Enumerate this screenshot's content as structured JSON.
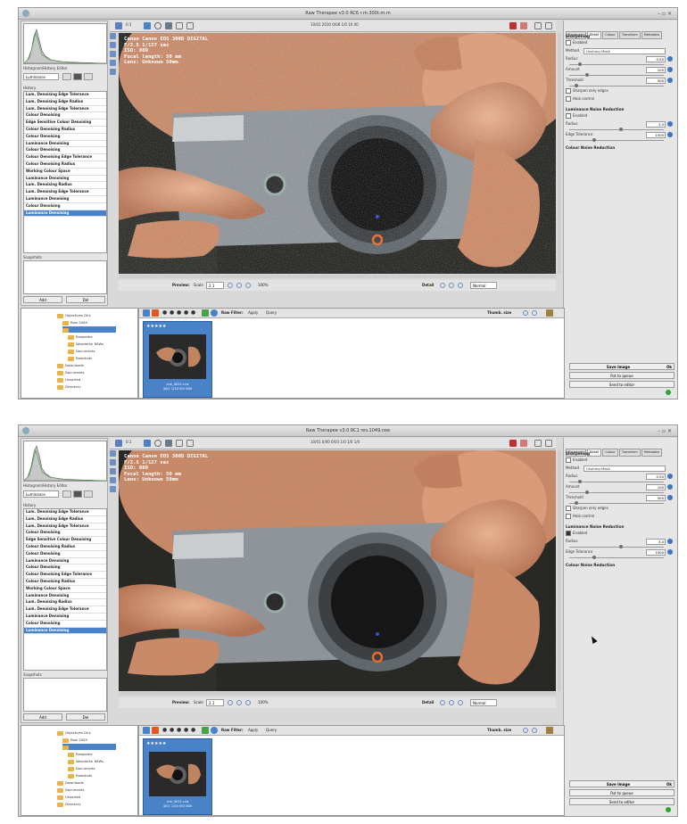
{
  "screens": [
    {
      "window_title": "Raw Therapee v3.0 RC6 r.m.300t.m.m",
      "photo_time": "10/01 2010 0/08 1/0 10 00",
      "exif": [
        "Canon Canon EOS 300D DIGITAL",
        "F/2.5 1/127 sec",
        "ISO: 800",
        "Focal length: 50 mm",
        "Lens: Unknown 50mm"
      ],
      "noise": "heavy",
      "cursor": false
    },
    {
      "window_title": "Raw Therapee v3.0 RC1 rev.1049.raw",
      "photo_time": "10/01 0/00 0/03 1/0 1/0 1/0",
      "exif": [
        "Canon Canon EOS 300D DIGITAL",
        "F/2.5 1/127 sec",
        "ISO: 800",
        "Focal length: 50 mm",
        "Lens: Unknown 50mm"
      ],
      "noise": "low",
      "cursor": true
    }
  ],
  "left_panel": {
    "histogram_label": "Histogram/History Editor",
    "histogram_select": "Luminance",
    "history_title": "History",
    "history_items": [
      "Lum. Denoising Edge Tolerance",
      "Lum. Denoising Edge Radius",
      "Lum. Denoising Edge Tolerance",
      "Colour Denoising",
      "Edge Sensitive Colour Denoising",
      "Colour Denoising Radius",
      "Colour Denoising",
      "Luminance Denoising",
      "Colour Denoising",
      "Colour Denoising Edge Tolerance",
      "Colour Denoising Radius",
      "Working Colour Space",
      "Luminance Denoising",
      "Lum. Denoising Radius",
      "Lum. Denoising Edge Tolerance",
      "Luminance Denoising",
      "Colour Denoising",
      "Luminance Denoising"
    ],
    "snapshot_title": "Snapshots",
    "snap_add": "Add",
    "snap_del": "Del"
  },
  "toolbar": {
    "left_text": "0:1"
  },
  "preview_bar": {
    "preview_label": "Preview:",
    "scale_label": "Scale",
    "scale_value": "2.1",
    "fit_label": "100%",
    "detail_label": "Detail",
    "detail_select": "Normal"
  },
  "right_panel": {
    "tabs": [
      "Exposure",
      "Detail",
      "Colour",
      "Transform",
      "Metadata"
    ],
    "sharpening_title": "Sharpening",
    "enabled_label": "Enabled",
    "method_label": "Method",
    "method_value": "Unsharp Mask",
    "radius_label": "Radius",
    "radius_value": "0.50",
    "amount_label": "Amount",
    "amount_value": "100",
    "threshold_label": "Threshold",
    "threshold_value": "500",
    "sharpen_edges_label": "Sharpen only edges",
    "halo_label": "Halo control",
    "lum_title": "Luminance Noise Reduction",
    "lum_radius_label": "Radius",
    "lum_radius_value": "3.0",
    "edge_tol_label": "Edge Tolerance",
    "edge_tol_value": "1500",
    "colour_nr_title": "Colour Noise Reduction",
    "save_image": "Save Image",
    "save_ok": "Ok",
    "put_queue": "Put to queue",
    "send_editor": "Send to editor"
  },
  "file_browser": {
    "items": [
      "Objectives Dirs",
      "Raw 2009",
      "",
      "Rawpedia",
      "Wonderful RAWs",
      "Documents",
      "Rawshots",
      "Downloads",
      "Documents",
      "Unsorted",
      "Directory"
    ]
  },
  "filmstrip": {
    "filter_label": "Raw Filter:",
    "apply_label": "Apply",
    "query_label": "Query",
    "thumb_zoom_label": "Thumb. size",
    "stars": "★★★★★",
    "thumb_caption_1": "crw_4021.crw",
    "thumb_caption_2": "3/01 1/10 ISO 800"
  },
  "colors": {
    "accent": "#4a82c8",
    "image_bg": "#1c1c1c",
    "panel": "#e6e6e6"
  }
}
